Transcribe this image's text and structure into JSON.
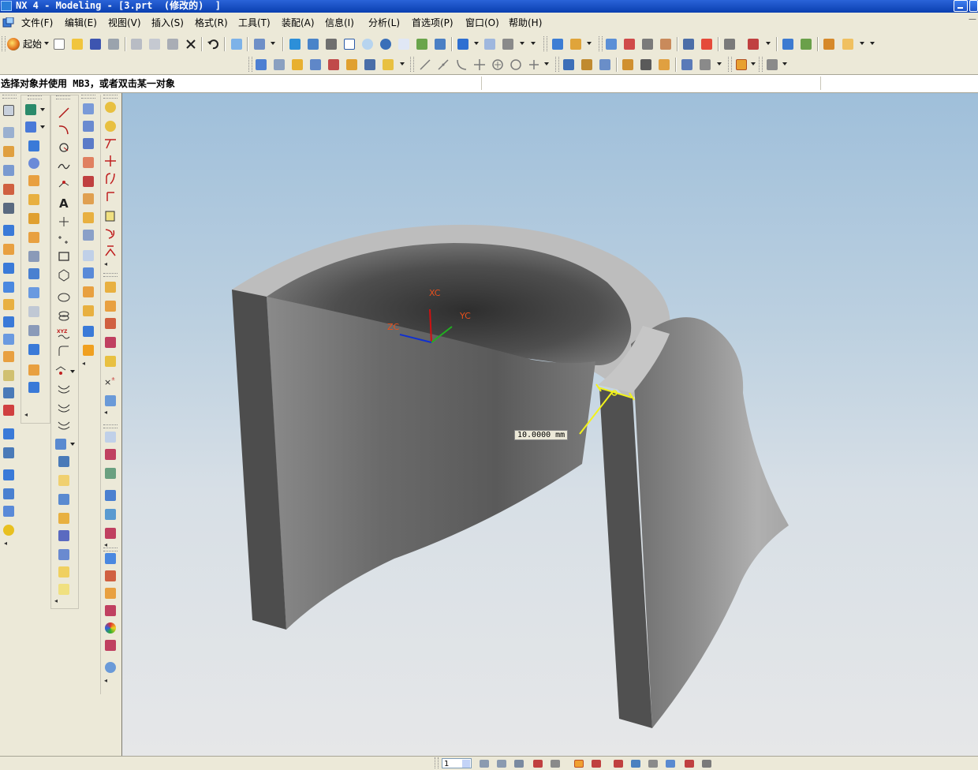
{
  "window": {
    "title": "NX 4 - Modeling - [3.prt  (修改的)  ]"
  },
  "menu": {
    "items": [
      "文件(F)",
      "编辑(E)",
      "视图(V)",
      "插入(S)",
      "格式(R)",
      "工具(T)",
      "装配(A)",
      "信息(I)",
      "分析(L)",
      "首选项(P)",
      "窗口(O)",
      "帮助(H)"
    ]
  },
  "toolbar": {
    "start_label": "起始"
  },
  "cue_line": {
    "text": "选择对象并使用 MB3，或者双击某一对象"
  },
  "viewport": {
    "axis_labels": {
      "xc": "XC",
      "yc": "YC",
      "zc": "ZC"
    },
    "dimension_label": "10.0000 mm",
    "colors": {
      "xc": "#d01010",
      "yc": "#20b020",
      "zc": "#1030d0",
      "axis_text": "#e8501c",
      "dimension": "#f2f21a"
    }
  },
  "status_bar": {
    "layer_value": "1"
  }
}
